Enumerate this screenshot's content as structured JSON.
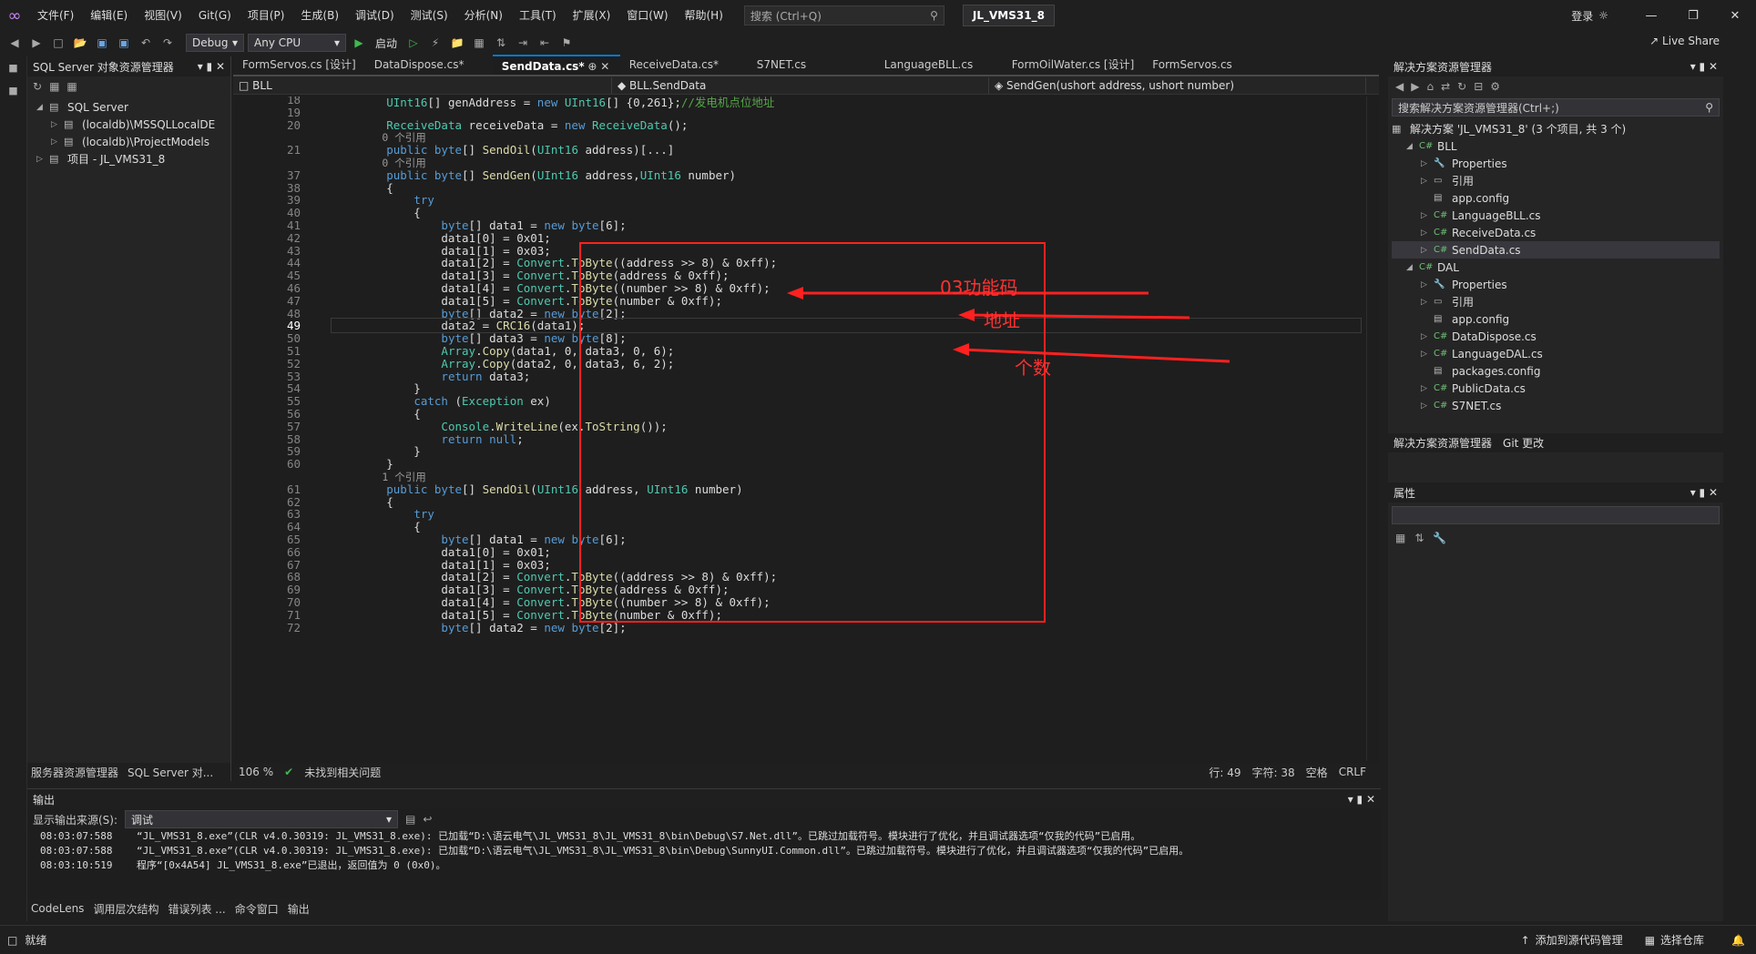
{
  "menubar": {
    "items": [
      "文件(F)",
      "编辑(E)",
      "视图(V)",
      "Git(G)",
      "项目(P)",
      "生成(B)",
      "调试(D)",
      "测试(S)",
      "分析(N)",
      "工具(T)",
      "扩展(X)",
      "窗口(W)",
      "帮助(H)"
    ],
    "search_placeholder": "搜索 (Ctrl+Q)",
    "solution_name": "JL_VMS31_8",
    "login": "登录",
    "live_share": "Live Share"
  },
  "toolbar": {
    "config": "Debug",
    "platform": "Any CPU",
    "start": "启动"
  },
  "sql_panel": {
    "title": "SQL Server 对象资源管理器",
    "nodes": [
      {
        "label": "SQL Server",
        "depth": 0
      },
      {
        "label": "(localdb)\\MSSQLLocalDE",
        "depth": 1
      },
      {
        "label": "(localdb)\\ProjectModels",
        "depth": 1
      },
      {
        "label": "项目 - JL_VMS31_8",
        "depth": 0
      }
    ],
    "bottom_tabs": [
      "服务器资源管理器",
      "SQL Server 对..."
    ]
  },
  "editor": {
    "tabs": [
      "FormServos.cs [设计]",
      "DataDispose.cs*",
      "SendData.cs*",
      "ReceiveData.cs*",
      "S7NET.cs",
      "LanguageBLL.cs",
      "FormOilWater.cs [设计]",
      "FormServos.cs"
    ],
    "active_tab": 2,
    "nav_project": "BLL",
    "nav_class": "BLL.SendData",
    "nav_member": "SendGen(ushort address, ushort number)",
    "zoom": "106 %",
    "issues": "未找到相关问题",
    "line_info": "行: 49",
    "col_info": "字符: 38",
    "space": "空格",
    "eol": "CRLF"
  },
  "annotations": {
    "func_code": "03功能码",
    "address": "地址",
    "count": "个数"
  },
  "solution": {
    "title": "解决方案资源管理器",
    "search": "搜索解决方案资源管理器(Ctrl+;)",
    "root": "解决方案 'JL_VMS31_8' (3 个项目, 共 3 个)",
    "items": [
      {
        "label": "BLL",
        "depth": 1,
        "icon": "C#"
      },
      {
        "label": "Properties",
        "depth": 2,
        "icon": "wrench"
      },
      {
        "label": "引用",
        "depth": 2,
        "icon": "ref"
      },
      {
        "label": "app.config",
        "depth": 2,
        "icon": "file"
      },
      {
        "label": "LanguageBLL.cs",
        "depth": 2,
        "icon": "C#"
      },
      {
        "label": "ReceiveData.cs",
        "depth": 2,
        "icon": "C#"
      },
      {
        "label": "SendData.cs",
        "depth": 2,
        "icon": "C#"
      },
      {
        "label": "DAL",
        "depth": 1,
        "icon": "C#"
      },
      {
        "label": "Properties",
        "depth": 2,
        "icon": "wrench"
      },
      {
        "label": "引用",
        "depth": 2,
        "icon": "ref"
      },
      {
        "label": "app.config",
        "depth": 2,
        "icon": "file"
      },
      {
        "label": "DataDispose.cs",
        "depth": 2,
        "icon": "C#"
      },
      {
        "label": "LanguageDAL.cs",
        "depth": 2,
        "icon": "C#"
      },
      {
        "label": "packages.config",
        "depth": 2,
        "icon": "file"
      },
      {
        "label": "PublicData.cs",
        "depth": 2,
        "icon": "C#"
      },
      {
        "label": "S7NET.cs",
        "depth": 2,
        "icon": "C#"
      }
    ],
    "bottom_tabs": [
      "解决方案资源管理器",
      "Git 更改"
    ],
    "properties_title": "属性"
  },
  "output": {
    "title": "输出",
    "source_label": "显示输出来源(S):",
    "source": "调试",
    "lines": [
      "08:03:07:588    “JL_VMS31_8.exe”(CLR v4.0.30319: JL_VMS31_8.exe): 已加载“D:\\语云电气\\JL_VMS31_8\\JL_VMS31_8\\bin\\Debug\\S7.Net.dll”。已跳过加载符号。模块进行了优化，并且调试器选项“仅我的代码”已启用。",
      "08:03:07:588    “JL_VMS31_8.exe”(CLR v4.0.30319: JL_VMS31_8.exe): 已加载“D:\\语云电气\\JL_VMS31_8\\JL_VMS31_8\\bin\\Debug\\SunnyUI.Common.dll”。已跳过加载符号。模块进行了优化，并且调试器选项“仅我的代码”已启用。",
      "08:03:10:519    程序“[0x4A54] JL_VMS31_8.exe”已退出，返回值为 0 (0x0)。"
    ],
    "bottom_tabs": [
      "CodeLens",
      "调用层次结构",
      "错误列表 ...",
      "命令窗口",
      "输出"
    ]
  },
  "status": {
    "ready": "就绪",
    "source_control": "添加到源代码管理",
    "repo": "选择仓库"
  },
  "code": [
    {
      "n": "18",
      "t": "        UInt16[] genAddress = new UInt16[] {0,261};//发电机点位地址"
    },
    {
      "n": "19",
      "t": ""
    },
    {
      "n": "20",
      "t": "        ReceiveData receiveData = new ReceiveData();"
    },
    {
      "n": "",
      "t": "        0 个引用"
    },
    {
      "n": "21",
      "t": "        public byte[] SendOil(UInt16 address)[...]"
    },
    {
      "n": "",
      "t": "        0 个引用"
    },
    {
      "n": "37",
      "t": "        public byte[] SendGen(UInt16 address,UInt16 number)"
    },
    {
      "n": "38",
      "t": "        {"
    },
    {
      "n": "39",
      "t": "            try"
    },
    {
      "n": "40",
      "t": "            {"
    },
    {
      "n": "41",
      "t": "                byte[] data1 = new byte[6];"
    },
    {
      "n": "42",
      "t": "                data1[0] = 0x01;"
    },
    {
      "n": "43",
      "t": "                data1[1] = 0x03;"
    },
    {
      "n": "44",
      "t": "                data1[2] = Convert.ToByte((address >> 8) & 0xff);"
    },
    {
      "n": "45",
      "t": "                data1[3] = Convert.ToByte(address & 0xff);"
    },
    {
      "n": "46",
      "t": "                data1[4] = Convert.ToByte((number >> 8) & 0xff);"
    },
    {
      "n": "47",
      "t": "                data1[5] = Convert.ToByte(number & 0xff);"
    },
    {
      "n": "48",
      "t": "                byte[] data2 = new byte[2];"
    },
    {
      "n": "49",
      "t": "                data2 = CRC16(data1);"
    },
    {
      "n": "50",
      "t": "                byte[] data3 = new byte[8];"
    },
    {
      "n": "51",
      "t": "                Array.Copy(data1, 0, data3, 0, 6);"
    },
    {
      "n": "52",
      "t": "                Array.Copy(data2, 0, data3, 6, 2);"
    },
    {
      "n": "53",
      "t": "                return data3;"
    },
    {
      "n": "54",
      "t": "            }"
    },
    {
      "n": "55",
      "t": "            catch (Exception ex)"
    },
    {
      "n": "56",
      "t": "            {"
    },
    {
      "n": "57",
      "t": "                Console.WriteLine(ex.ToString());"
    },
    {
      "n": "58",
      "t": "                return null;"
    },
    {
      "n": "59",
      "t": "            }"
    },
    {
      "n": "60",
      "t": "        }"
    },
    {
      "n": "",
      "t": "        1 个引用"
    },
    {
      "n": "61",
      "t": "        public byte[] SendOil(UInt16 address, UInt16 number)"
    },
    {
      "n": "62",
      "t": "        {"
    },
    {
      "n": "63",
      "t": "            try"
    },
    {
      "n": "64",
      "t": "            {"
    },
    {
      "n": "65",
      "t": "                byte[] data1 = new byte[6];"
    },
    {
      "n": "66",
      "t": "                data1[0] = 0x01;"
    },
    {
      "n": "67",
      "t": "                data1[1] = 0x03;"
    },
    {
      "n": "68",
      "t": "                data1[2] = Convert.ToByte((address >> 8) & 0xff);"
    },
    {
      "n": "69",
      "t": "                data1[3] = Convert.ToByte(address & 0xff);"
    },
    {
      "n": "70",
      "t": "                data1[4] = Convert.ToByte((number >> 8) & 0xff);"
    },
    {
      "n": "71",
      "t": "                data1[5] = Convert.ToByte(number & 0xff);"
    },
    {
      "n": "72",
      "t": "                byte[] data2 = new byte[2];"
    }
  ]
}
